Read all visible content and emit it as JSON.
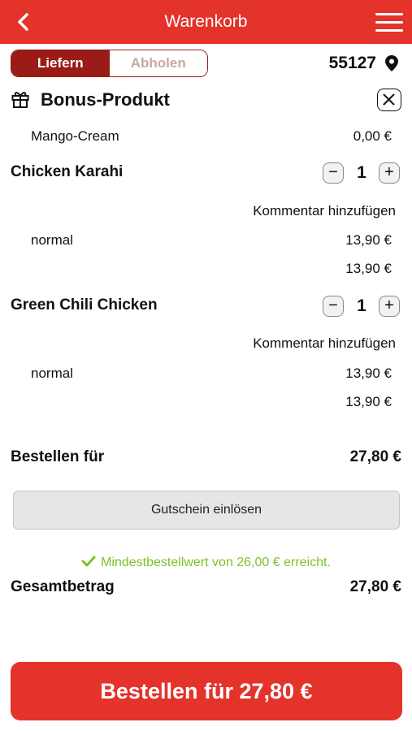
{
  "header": {
    "title": "Warenkorb",
    "back_icon": "chevron-left-icon",
    "menu_icon": "hamburger-menu-icon"
  },
  "delivery_toggle": {
    "deliver_label": "Liefern",
    "pickup_label": "Abholen",
    "selected": "Liefern"
  },
  "location": {
    "postcode": "55127",
    "icon": "map-pin-icon"
  },
  "bonus": {
    "title": "Bonus-Produkt",
    "icon": "gift-icon",
    "close_icon": "close-icon",
    "item_name": "Mango-Cream",
    "item_price": "0,00 €"
  },
  "items": [
    {
      "name": "Chicken Karahi",
      "quantity": "1",
      "comment_label": "Kommentar hinzufügen",
      "option": "normal",
      "option_price": "13,90 €",
      "total": "13,90 €"
    },
    {
      "name": "Green Chili Chicken",
      "quantity": "1",
      "comment_label": "Kommentar hinzufügen",
      "option": "normal",
      "option_price": "13,90 €",
      "total": "13,90 €"
    }
  ],
  "summary": {
    "subtotal_label": "Bestellen für",
    "subtotal_value": "27,80 €",
    "voucher_label": "Gutschein einlösen",
    "min_order_msg": "Mindestbestellwert von 26,00 € erreicht.",
    "total_label": "Gesamtbetrag",
    "total_value": "27,80 €"
  },
  "order_button": {
    "label": "Bestellen für 27,80 €"
  },
  "colors": {
    "brand_red": "#e3332a",
    "dark_red": "#9b1b16",
    "success_green": "#7cc327"
  }
}
